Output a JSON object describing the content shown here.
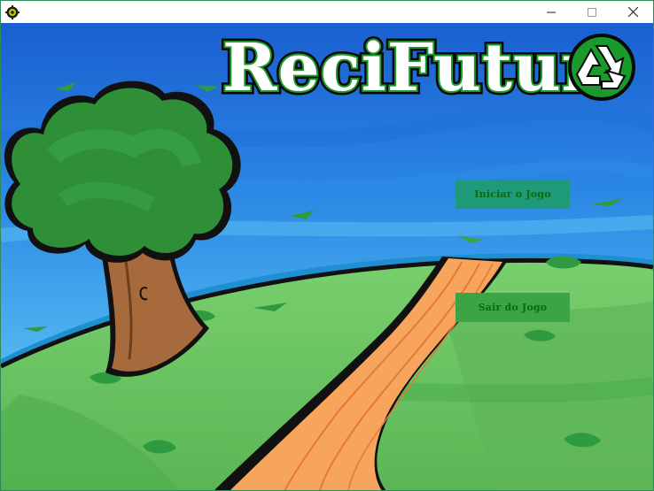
{
  "window": {
    "controls": {
      "minimize_icon": "minimize-icon",
      "maximize_icon": "maximize-icon",
      "close_icon": "close-icon"
    }
  },
  "game": {
    "logo_text": "ReciFutur",
    "logo_icon": "recycle-icon",
    "start_button_label": "Iniciar o Jogo",
    "exit_button_label": "Sair do Jogo"
  },
  "colors": {
    "sky_top": "#1c6fd8",
    "sky_horizon": "#6fcdf6",
    "grass": "#6cc564",
    "grass_dark": "#2f9a3f",
    "path": "#f39a52",
    "logo_green": "#1a9a2a",
    "start_button_bg": "#1e9a78",
    "exit_button_bg": "#3aa447",
    "button_text": "#0b6b0b"
  }
}
